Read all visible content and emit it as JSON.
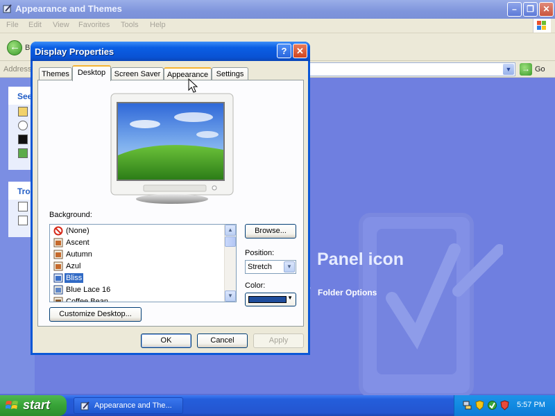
{
  "explorer": {
    "title": "Appearance and Themes",
    "menu": [
      "File",
      "Edit",
      "View",
      "Favorites",
      "Tools",
      "Help"
    ],
    "back_label": "B",
    "address_label": "Address",
    "go_label": "Go",
    "side_panels": [
      {
        "heading": "See"
      },
      {
        "heading": "Tro"
      }
    ],
    "pane_heading": "Panel icon",
    "folder_link": "Folder Options"
  },
  "dialog": {
    "title": "Display Properties",
    "help_glyph": "?",
    "close_glyph": "✕",
    "tabs": [
      "Themes",
      "Desktop",
      "Screen Saver",
      "Appearance",
      "Settings"
    ],
    "active_tab": "Desktop",
    "background_label": "Background:",
    "backgrounds": [
      {
        "name": "(None)",
        "icon": "none-icon"
      },
      {
        "name": "Ascent",
        "icon": "wallpaper-icon"
      },
      {
        "name": "Autumn",
        "icon": "wallpaper-icon"
      },
      {
        "name": "Azul",
        "icon": "wallpaper-icon"
      },
      {
        "name": "Bliss",
        "icon": "wallpaper-icon",
        "selected": true
      },
      {
        "name": "Blue Lace 16",
        "icon": "wallpaper-icon"
      },
      {
        "name": "Coffee Bean",
        "icon": "wallpaper-icon"
      }
    ],
    "browse_label": "Browse...",
    "position_label": "Position:",
    "position_value": "Stretch",
    "color_label": "Color:",
    "color_value": "#1f4d9c",
    "customize_label": "Customize Desktop...",
    "ok_label": "OK",
    "cancel_label": "Cancel",
    "apply_label": "Apply"
  },
  "taskbar": {
    "start_label": "start",
    "task_label": "Appearance and The...",
    "clock": "5:57 PM"
  }
}
